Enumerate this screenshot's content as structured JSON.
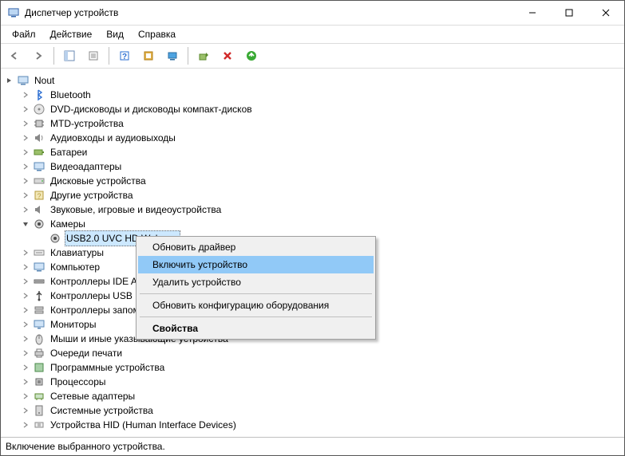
{
  "titlebar": {
    "title": "Диспетчер устройств"
  },
  "menu": {
    "file": "Файл",
    "action": "Действие",
    "view": "Вид",
    "help": "Справка"
  },
  "tree": {
    "root": "Nout",
    "items": [
      "Bluetooth",
      "DVD-дисководы и дисководы компакт-дисков",
      "MTD-устройства",
      "Аудиовходы и аудиовыходы",
      "Батареи",
      "Видеоадаптеры",
      "Дисковые устройства",
      "Другие устройства",
      "Звуковые, игровые и видеоустройства",
      "Камеры",
      "Клавиатуры",
      "Компьютер",
      "Контроллеры IDE ATA/ATAPI",
      "Контроллеры USB",
      "Контроллеры запоминающих устройств",
      "Мониторы",
      "Мыши и иные указывающие устройства",
      "Очереди печати",
      "Программные устройства",
      "Процессоры",
      "Сетевые адаптеры",
      "Системные устройства",
      "Устройства HID (Human Interface Devices)"
    ],
    "camera_child": "USB2.0 UVC HD Webcam"
  },
  "context": {
    "update": "Обновить драйвер",
    "enable": "Включить устройство",
    "delete": "Удалить устройство",
    "refresh": "Обновить конфигурацию оборудования",
    "properties": "Свойства"
  },
  "status": "Включение выбранного устройства."
}
